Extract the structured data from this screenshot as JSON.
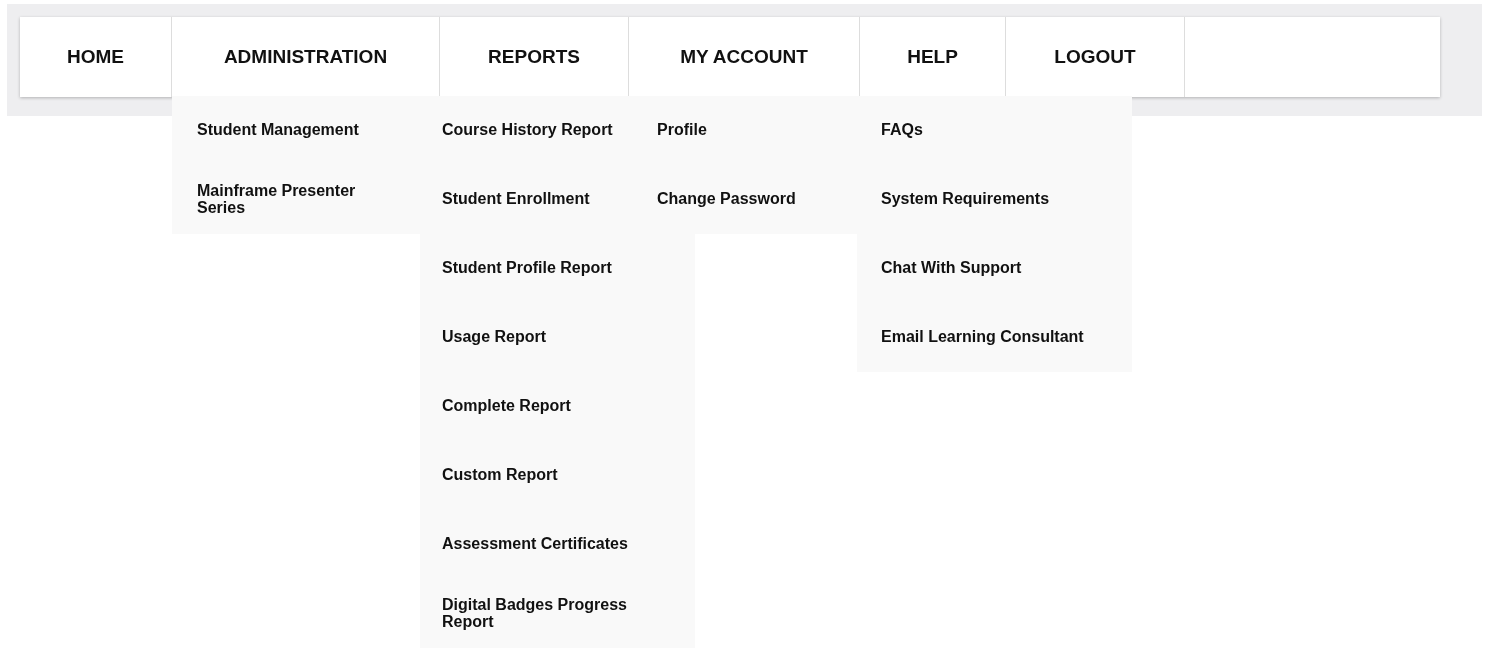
{
  "nav": [
    {
      "label": "HOME"
    },
    {
      "label": "ADMINISTRATION",
      "items": [
        "Student Management",
        "Mainframe Presenter Series"
      ]
    },
    {
      "label": "REPORTS",
      "items": [
        "Course History Report",
        "Student Enrollment",
        "Student Profile Report",
        "Usage Report",
        "Complete Report",
        "Custom Report",
        "Assessment Certificates",
        "Digital Badges Progress Report"
      ]
    },
    {
      "label": "MY ACCOUNT",
      "items": [
        "Profile",
        "Change Password"
      ]
    },
    {
      "label": "HELP",
      "items": [
        "FAQs",
        "System Requirements",
        "Chat With Support",
        "Email Learning Consultant"
      ]
    },
    {
      "label": "LOGOUT"
    }
  ]
}
